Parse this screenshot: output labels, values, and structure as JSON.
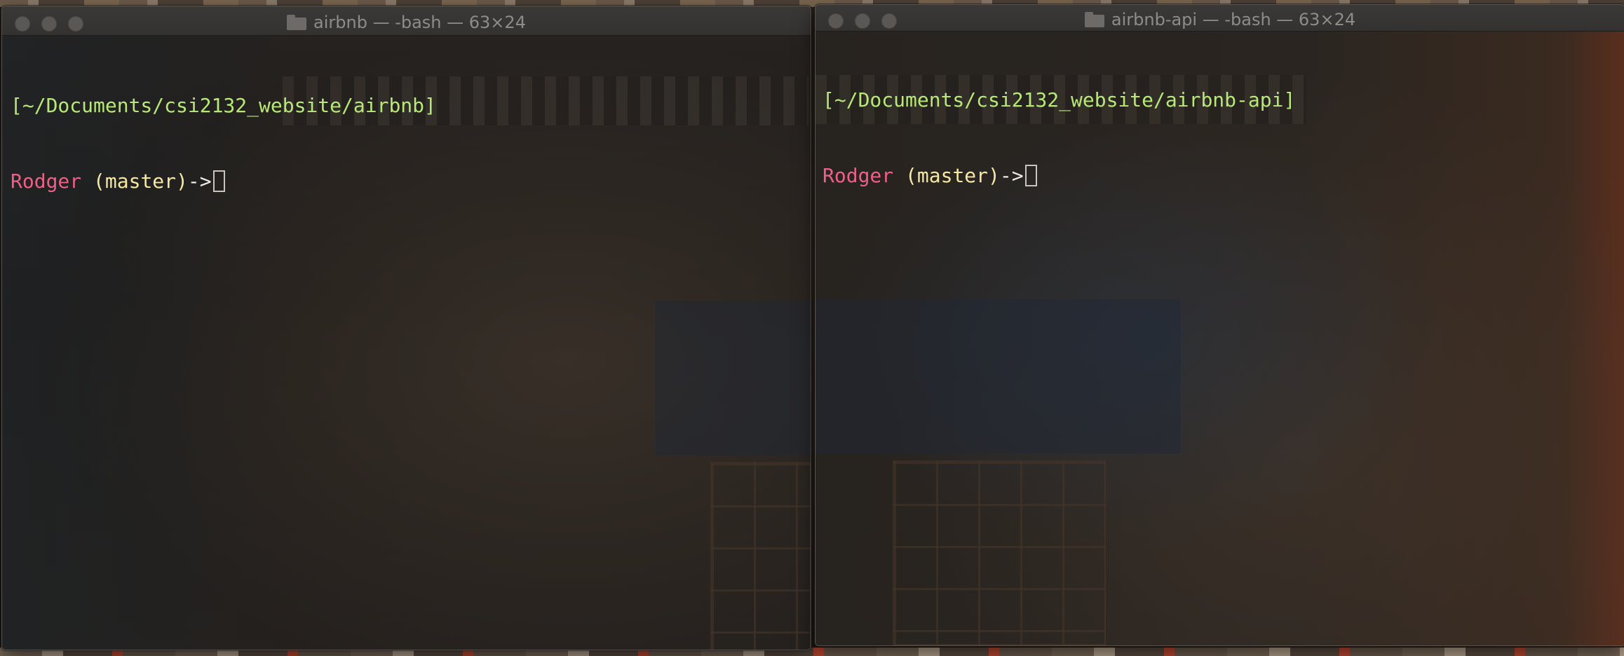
{
  "desktop": {
    "wallpaper": "japanese-shopfront-photo"
  },
  "windows": [
    {
      "title": "airbnb — -bash — 63×24",
      "title_icon": "folder-icon",
      "controls": [
        "close",
        "minimize",
        "zoom"
      ],
      "lines": {
        "path": "[~/Documents/csi2132_website/airbnb]",
        "user": "Rodger",
        "branch": " (master)",
        "arrow": "->"
      }
    },
    {
      "title": "airbnb-api — -bash — 63×24",
      "title_icon": "folder-icon",
      "controls": [
        "close",
        "minimize",
        "zoom"
      ],
      "lines": {
        "path": "[~/Documents/csi2132_website/airbnb-api]",
        "user": "Rodger",
        "branch": " (master)",
        "arrow": "->"
      }
    }
  ],
  "colors": {
    "path": "#b7e878",
    "user": "#ef5f87",
    "branch": "#f4e8a2",
    "title_text": "#8e8b88"
  }
}
